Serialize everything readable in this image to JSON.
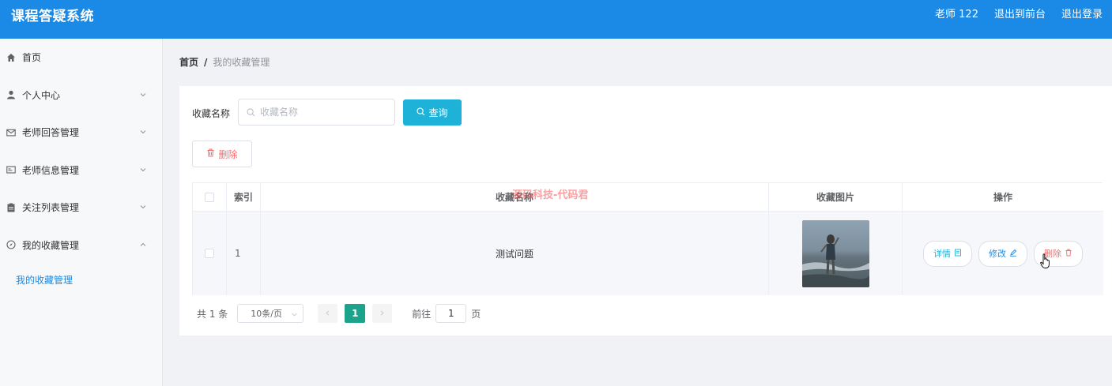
{
  "header": {
    "title": "课程答疑系统",
    "user": "老师 122",
    "to_front": "退出到前台",
    "logout": "退出登录",
    "bg_color": "#1a8ae6"
  },
  "sidebar": {
    "items": [
      {
        "label": "首页",
        "icon": "home-icon"
      },
      {
        "label": "个人中心",
        "icon": "user-icon",
        "expandable": true
      },
      {
        "label": "老师回答管理",
        "icon": "mail-icon",
        "expandable": true
      },
      {
        "label": "老师信息管理",
        "icon": "id-card-icon",
        "expandable": true
      },
      {
        "label": "关注列表管理",
        "icon": "clipboard-icon",
        "expandable": true
      },
      {
        "label": "我的收藏管理",
        "icon": "compass-icon",
        "expandable": true,
        "expanded": true
      }
    ],
    "submenu": [
      {
        "label": "我的收藏管理",
        "active": true
      }
    ]
  },
  "breadcrumb": {
    "home": "首页",
    "separator": "/",
    "current": "我的收藏管理"
  },
  "search": {
    "label": "收藏名称",
    "placeholder": "收藏名称",
    "value": "",
    "button": "查询"
  },
  "actions": {
    "delete": "删除"
  },
  "table": {
    "columns": [
      "",
      "索引",
      "收藏名称",
      "收藏图片",
      "操作"
    ],
    "rows": [
      {
        "index": "1",
        "name": "测试问题",
        "image": "beach-photo",
        "ops": {
          "detail": "详情",
          "edit": "修改",
          "delete": "删除"
        }
      }
    ]
  },
  "watermark": "源码科技-代码君",
  "pagination": {
    "total": "共 1 条",
    "page_size": "10条/页",
    "current_page": "1",
    "goto_label": "前往",
    "goto_value": "1",
    "page_suffix": "页"
  },
  "colors": {
    "accent": "#1a8ae6",
    "query_button": "#1eb2d8",
    "danger": "#f56c6c",
    "page_active": "#1ba38c"
  }
}
